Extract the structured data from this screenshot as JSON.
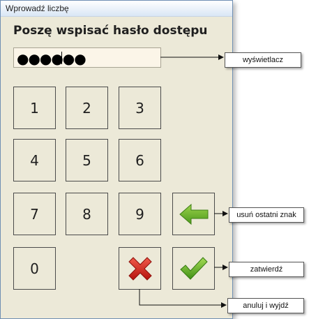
{
  "window": {
    "title": "Wprowadź liczbę"
  },
  "heading": "Poszę wspisać hasło dostępu",
  "display": {
    "value": "●●●●●●"
  },
  "keypad": {
    "keys": [
      "1",
      "2",
      "3",
      "4",
      "5",
      "6",
      "7",
      "8",
      "9",
      "0"
    ],
    "backspace_icon": "green-left-arrow-icon",
    "cancel_icon": "red-x-icon",
    "confirm_icon": "green-checkmark-icon"
  },
  "callouts": {
    "display": "wyświetlacz",
    "backspace": "usuń ostatni znak",
    "confirm": "zatwierdź",
    "cancel": "anuluj i wyjdź"
  },
  "colors": {
    "window_bg": "#ece9d8",
    "arrow_green": "#6fb02d",
    "cancel_red": "#cc1f1a",
    "check_green": "#5aa820"
  }
}
